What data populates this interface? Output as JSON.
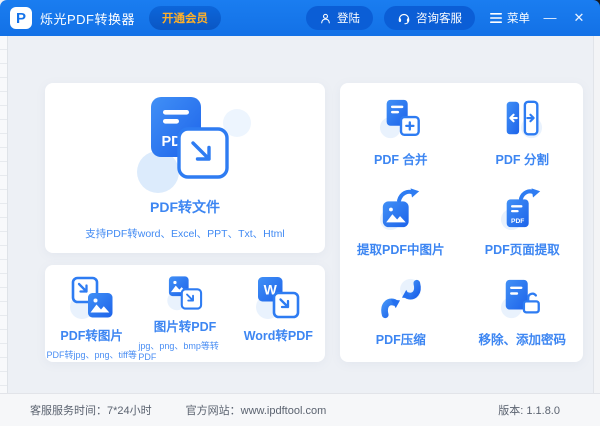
{
  "titlebar": {
    "app_name": "烁光PDF转换器",
    "vip_button_label": "开通会员",
    "login_label": "登陆",
    "support_label": "咨询客服",
    "menu_label": "菜单",
    "minimize_glyph": "—",
    "close_glyph": "✕",
    "logo_letter": "P"
  },
  "pdf_to_file_card": {
    "title": "PDF转文件",
    "subtitle": "支持PDF转word、Excel、PPT、Txt、Html",
    "icon_badge": "PDF"
  },
  "convert_cards": [
    {
      "title": "PDF转图片",
      "subtitle": "PDF转jpg、png、tiff等"
    },
    {
      "title": "图片转PDF",
      "subtitle": "jpg、png、bmp等转PDF"
    },
    {
      "title": "Word转PDF",
      "subtitle": "",
      "icon_letter": "W"
    }
  ],
  "tools": [
    {
      "label": "PDF 合并"
    },
    {
      "label": "PDF 分割"
    },
    {
      "label": "提取PDF中图片"
    },
    {
      "label": "PDF页面提取",
      "icon_badge": "PDF"
    },
    {
      "label": "PDF压缩"
    },
    {
      "label": "移除、添加密码"
    }
  ],
  "statusbar": {
    "service_time": "客服服务时间：7*24小时",
    "website": "官方网站：www.ipdftool.com",
    "version": "版本: 1.1.8.0"
  },
  "colors": {
    "titlebar_blue": "#1577ea",
    "accent_blue": "#2e7cf2",
    "label_blue": "#3d86f2",
    "vip_text_orange": "#ffb028",
    "content_bg": "#edf0f5"
  }
}
